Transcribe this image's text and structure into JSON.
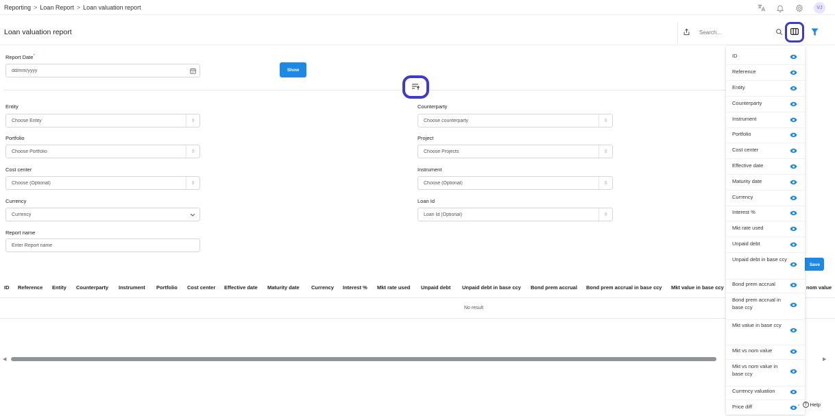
{
  "breadcrumb": [
    "Reporting",
    "Loan Report",
    "Loan valuation report"
  ],
  "breadcrumb_sep": ">",
  "user": {
    "initials": "VJ"
  },
  "page_title": "Loan valuation report",
  "search": {
    "placeholder": "Search..."
  },
  "form": {
    "report_date": {
      "label": "Report Date",
      "required_mark": "*",
      "placeholder": "dd/mm/yyyy"
    },
    "show_label": "Show",
    "entity": {
      "label": "Entity",
      "placeholder": "Choose Entity"
    },
    "counterparty": {
      "label": "Counterparty",
      "placeholder": "Choose counterparty"
    },
    "portfolio": {
      "label": "Portfolio",
      "placeholder": "Choose Portfolio"
    },
    "project": {
      "label": "Project",
      "placeholder": "Choose Projects"
    },
    "cost_center": {
      "label": "Cost center",
      "placeholder": "Choose (Optional)"
    },
    "instrument": {
      "label": "Instrument",
      "placeholder": "Choose (Optional)"
    },
    "currency": {
      "label": "Currency",
      "placeholder": "Currency"
    },
    "loan_id": {
      "label": "Loan Id",
      "placeholder": "Loan Id (Optional)"
    },
    "report_name": {
      "label": "Report name",
      "placeholder": "Enter Report name"
    },
    "save_label": "Save"
  },
  "table": {
    "headers": [
      "ID",
      "Reference",
      "Entity",
      "Counterparty",
      "Instrument",
      "Portfolio",
      "Cost center",
      "Effective date",
      "Maturity date",
      "Currency",
      "Interest %",
      "Mkt rate used",
      "Unpaid debt",
      "Unpaid debt in base ccy",
      "Bond prem accrual",
      "Bond prem accrual in base ccy",
      "Mkt value in base ccy"
    ],
    "trailing_header": "nom value",
    "empty_text": "No result"
  },
  "column_panel": {
    "items": [
      "ID",
      "Reference",
      "Entity",
      "Counterparty",
      "Instrument",
      "Portfolio",
      "Cost center",
      "Effective date",
      "Maturity date",
      "Currency",
      "Interest %",
      "Mkt rate used",
      "Unpaid debt",
      "Unpaid debt in base ccy",
      "Bond prem accrual",
      "Bond prem accrual in base ccy",
      "Mkt value in base ccy",
      "Mkt vs nom value",
      "Mkt vs nom value in base ccy",
      "Currency valuation",
      "Price diff"
    ]
  },
  "help_label": "Help",
  "colors": {
    "primary": "#1e88e5",
    "highlight": "#3c3cc9"
  }
}
